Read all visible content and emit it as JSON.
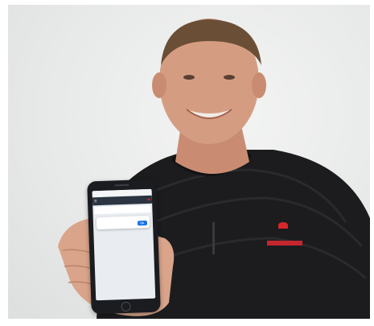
{
  "photo": {
    "subject": "man",
    "accent_color": "#c4262e"
  },
  "phone_screen": {
    "url_bar": "",
    "app_title": "",
    "app_cta": "",
    "card": {
      "title": "",
      "rows": [
        {
          "left": "",
          "right": ""
        },
        {
          "left": "",
          "right": ""
        },
        {
          "left": "",
          "right": ""
        }
      ]
    },
    "dialog": {
      "title": "",
      "text": "",
      "button": "OK"
    }
  },
  "shirt_logo": {
    "text": "",
    "color": "#c4262e"
  }
}
